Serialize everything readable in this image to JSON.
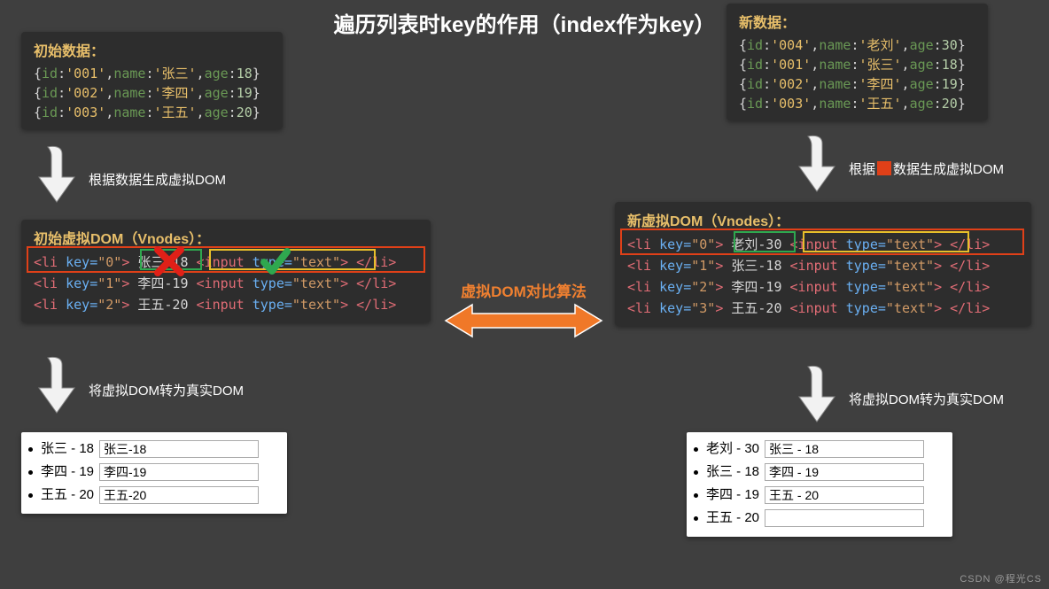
{
  "title": "遍历列表时key的作用（index作为key）",
  "left": {
    "data_panel": {
      "title": "初始数据：",
      "rows": [
        {
          "id": "'001'",
          "name": "'张三'",
          "age": "18"
        },
        {
          "id": "'002'",
          "name": "'李四'",
          "age": "19"
        },
        {
          "id": "'003'",
          "name": "'王五'",
          "age": "20"
        }
      ]
    },
    "arrow1_label": "根据数据生成虚拟DOM",
    "vdom_panel": {
      "title": "初始虚拟DOM（Vnodes）：",
      "rows": [
        {
          "key": "\"0\"",
          "text": "张三-18"
        },
        {
          "key": "\"1\"",
          "text": "李四-19"
        },
        {
          "key": "\"2\"",
          "text": "王五-20"
        }
      ],
      "input_snippet_open": "<input ",
      "input_snippet_mid": "type=",
      "input_snippet_val": "\"text\"",
      "input_snippet_close": ">"
    },
    "arrow2_label": "将虚拟DOM转为真实DOM",
    "real_panel": {
      "rows": [
        {
          "label": "张三 - 18",
          "value": "张三-18"
        },
        {
          "label": "李四 - 19",
          "value": "李四-19"
        },
        {
          "label": "王五 - 20",
          "value": "王五-20"
        }
      ]
    }
  },
  "right": {
    "data_panel": {
      "title": "新数据：",
      "rows": [
        {
          "id": "'004'",
          "name": "'老刘'",
          "age": "30"
        },
        {
          "id": "'001'",
          "name": "'张三'",
          "age": "18"
        },
        {
          "id": "'002'",
          "name": "'李四'",
          "age": "19"
        },
        {
          "id": "'003'",
          "name": "'王五'",
          "age": "20"
        }
      ]
    },
    "arrow1_label_pre": "根据",
    "arrow1_label_post": "数据生成虚拟DOM",
    "vdom_panel": {
      "title": "新虚拟DOM（Vnodes）：",
      "rows": [
        {
          "key": "\"0\"",
          "text": "老刘-30"
        },
        {
          "key": "\"1\"",
          "text": "张三-18"
        },
        {
          "key": "\"2\"",
          "text": "李四-19"
        },
        {
          "key": "\"3\"",
          "text": "王五-20"
        }
      ]
    },
    "arrow2_label": "将虚拟DOM转为真实DOM",
    "real_panel": {
      "rows": [
        {
          "label": "老刘 - 30",
          "value": "张三 - 18"
        },
        {
          "label": "张三 - 18",
          "value": "李四 - 19"
        },
        {
          "label": "李四 - 19",
          "value": "王五 - 20"
        },
        {
          "label": "王五 - 20",
          "value": ""
        }
      ]
    }
  },
  "compare_label": "虚拟DOM对比算法",
  "li_open": "<li ",
  "li_key_attr": "key=",
  "li_close": "</li>",
  "watermark": "CSDN @程光CS"
}
